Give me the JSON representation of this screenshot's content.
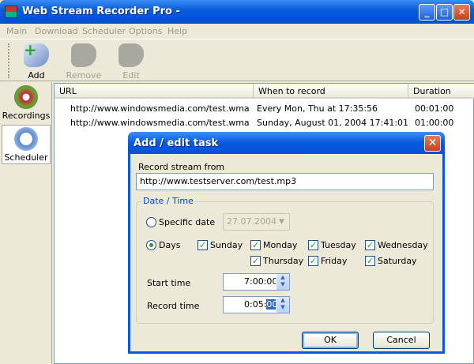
{
  "window": {
    "title": "Web Stream Recorder Pro -",
    "minimize": "_",
    "maximize": "□",
    "close": "✕"
  },
  "menu": [
    "Main",
    "Download",
    "Scheduler",
    "Options",
    "Help"
  ],
  "toolbar": {
    "add": "Add",
    "remove": "Remove",
    "edit": "Edit"
  },
  "sidebar": {
    "recordings": "Recordings",
    "scheduler": "Scheduler"
  },
  "list": {
    "columns": [
      "URL",
      "When to record",
      "Duration"
    ],
    "rows": [
      {
        "url": "http://www.windowsmedia.com/test.wma",
        "when": "Every Mon, Thu at 17:35:56",
        "duration": "00:01:00"
      },
      {
        "url": "http://www.windowsmedia.com/test.wma",
        "when": "Sunday, August 01, 2004 17:41:01",
        "duration": "01:00:00"
      }
    ]
  },
  "dialog": {
    "title": "Add / edit task",
    "close": "✕",
    "stream_label": "Record stream from",
    "stream_value": "http://www.testserver.com/test.mp3",
    "group_label": "Date / Time",
    "specific_date_label": "Specific date",
    "specific_date_value": "27.07.2004",
    "days_label": "Days",
    "days": [
      "Sunday",
      "Monday",
      "Tuesday",
      "Wednesday",
      "Thursday",
      "Friday",
      "Saturday"
    ],
    "start_time_label": "Start time",
    "start_time_value": "7:00:00",
    "record_time_label": "Record time",
    "record_time_prefix": "0:05:",
    "record_time_selected": "00",
    "ok": "OK",
    "cancel": "Cancel"
  }
}
